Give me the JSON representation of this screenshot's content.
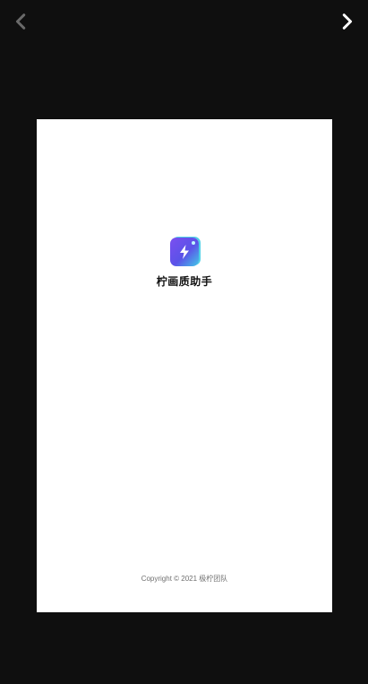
{
  "viewer": {
    "prev_icon": "chevron-left-icon",
    "next_icon": "chevron-right-icon",
    "colors": {
      "background": "#0f0f0f",
      "prev_arrow": "#6a6a6a",
      "next_arrow": "#ffffff"
    }
  },
  "splash": {
    "app_icon": "lightning-bolt-icon",
    "app_name": "柠画质助手",
    "copyright": "Copyright © 2021 极柠团队",
    "colors": {
      "icon_primary": "#6a52ee",
      "icon_accent": "#43c6e8"
    }
  }
}
